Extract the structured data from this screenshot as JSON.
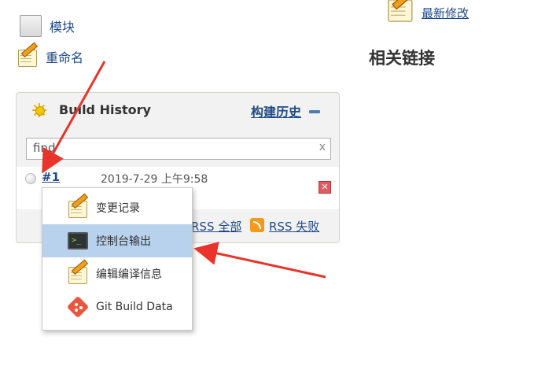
{
  "tasks": {
    "module": "模块",
    "rename": "重命名"
  },
  "right": {
    "recent_changes": "最新修改",
    "related_links": "相关链接"
  },
  "build_history": {
    "title": "Build History",
    "trend": "构建历史",
    "search_placeholder": "find",
    "search_value": "find",
    "clear": "x",
    "builds": [
      {
        "number": "#1",
        "date": "2019-7-29 上午9:58",
        "status": "not-built"
      }
    ],
    "rss_all": "RSS 全部",
    "rss_failed": "RSS 失败"
  },
  "context_menu": {
    "items": [
      {
        "label": "变更记录",
        "icon": "notepad-icon",
        "active": false
      },
      {
        "label": "控制台输出",
        "icon": "console-icon",
        "active": true
      },
      {
        "label": "编辑编译信息",
        "icon": "notepad-icon",
        "active": false
      },
      {
        "label": "Git Build Data",
        "icon": "git-icon",
        "active": false
      }
    ]
  },
  "colors": {
    "link": "#204a87",
    "menu_active": "#b8d2ee",
    "annotation_arrow": "#e8342a"
  }
}
